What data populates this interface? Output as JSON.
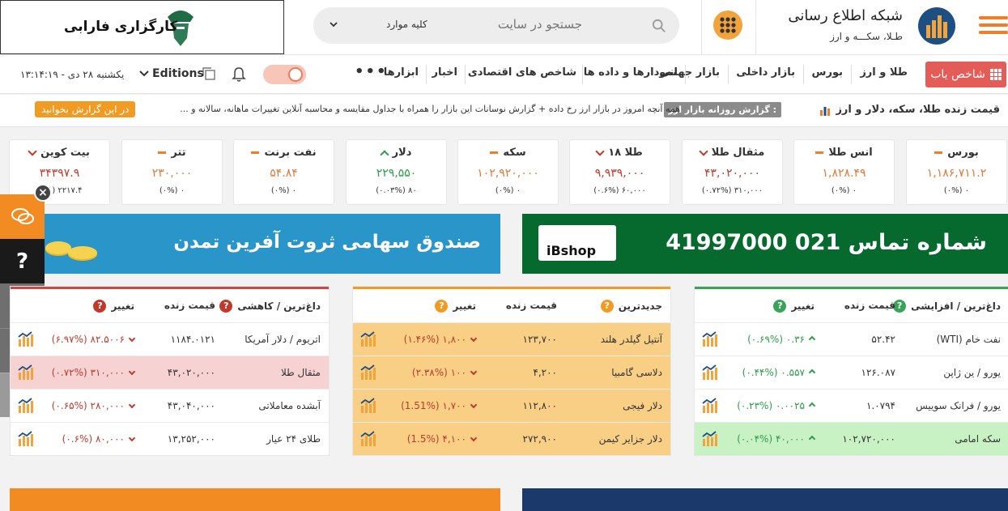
{
  "header": {
    "site_title": "شبکه اطلاع رسانی",
    "site_subtitle": "طـلا، سکـــه و ارز",
    "search_placeholder": "جستجو در سایت",
    "search_scope": "کلیه موارد",
    "ad_text": "کارگزاری فارابی"
  },
  "nav": {
    "finder_label": "شاخص یاب",
    "items": [
      "طلا و ارز",
      "بورس",
      "بازار داخلی",
      "بازار جهانی",
      "نمودارها و داده ها",
      "شاخص های اقتصادی",
      "اخبار",
      "ابزارها"
    ],
    "more": "•••",
    "editions": "Editions",
    "date": "یکشنبه ۲۸ دی - ۱۳:۱۴:۱۹"
  },
  "ticker": {
    "title": "قیمت زنده طلا، سکه، دلار و ارز",
    "badge": "گزارش روزانه بازار ارز :",
    "text": "همه آنچه امروز در بازار ارز رخ داده + گزارش نوسانات این بازار را همراه با جداول مقایسه و محاسبه آنلاین تغییرات ماهانه، سالانه و ...",
    "link": "در این گزارش بخوانید"
  },
  "cards": [
    {
      "name": "بورس",
      "value": "۱,۱۸۶,۷۱۱.۲",
      "change": "۰ (۰%)",
      "dir": "flat"
    },
    {
      "name": "انس طلا",
      "value": "۱,۸۲۸.۴۹",
      "change": "۰ (۰%)",
      "dir": "flat"
    },
    {
      "name": "مثقال طلا",
      "value": "۴۳,۰۲۰,۰۰۰",
      "change": "۳۱۰,۰۰۰ (۰.۷۲%)",
      "dir": "down"
    },
    {
      "name": "طلا ۱۸",
      "value": "۹,۹۳۹,۰۰۰",
      "change": "۶۰,۰۰۰ (۰.۶%)",
      "dir": "down"
    },
    {
      "name": "سکه",
      "value": "۱۰۲,۹۲۰,۰۰۰",
      "change": "۰ (۰%)",
      "dir": "flat"
    },
    {
      "name": "دلار",
      "value": "۲۲۹,۵۵۰",
      "change": "۸۰ (۰.۰۳%)",
      "dir": "up"
    },
    {
      "name": "نفت برنت",
      "value": "۵۴.۸۴",
      "change": "۰ (۰%)",
      "dir": "flat"
    },
    {
      "name": "تتر",
      "value": "۲۳۰,۰۰۰",
      "change": "۰ (۰%)",
      "dir": "flat"
    },
    {
      "name": "بیت کوین",
      "value": "۳۴۳۹۷.۹",
      "change": "۲۲۱۷.۴ (۶%)",
      "dir": "down"
    }
  ],
  "banners": {
    "right": "شماره تماس 021 41997000",
    "right_logo": "iBshop",
    "left": "صندوق سهامی ثروت آفرین تمدن"
  },
  "tables": {
    "gainers": {
      "headers": [
        "داغ‌ترین / افزایشی",
        "قیمت زنده",
        "تغییر"
      ],
      "rows": [
        {
          "name": "نفت خام (WTI)",
          "price": "۵۲.۴۲",
          "change": "۰.۳۶ (۰.۶۹%)"
        },
        {
          "name": "یورو / ین ژاپن",
          "price": "۱۲۶.۰۸۷",
          "change": "۰.۵۵۷ (۰.۴۴%)"
        },
        {
          "name": "یورو / فرانک سوییس",
          "price": "۱.۰۷۹۴",
          "change": "۰.۰۰۲۵ (۰.۲۳%)"
        },
        {
          "name": "سکه امامی",
          "price": "۱۰۲,۷۲۰,۰۰۰",
          "change": "۴۰,۰۰۰ (۰.۰۴%)"
        }
      ]
    },
    "newest": {
      "headers": [
        "جدیدترین",
        "قیمت زنده",
        "تغییر"
      ],
      "rows": [
        {
          "name": "آنتیل گیلدر هلند",
          "price": "۱۲۳,۷۰۰",
          "change": "۱,۸۰۰ (۱.۴۶%)"
        },
        {
          "name": "دلاسی گامبیا",
          "price": "۴,۲۰۰",
          "change": "۱۰۰ (۲.۳۸%)"
        },
        {
          "name": "دلار فیجی",
          "price": "۱۱۲,۸۰۰",
          "change": "۱,۷۰۰ (1.51%)"
        },
        {
          "name": "دلار جزایر کیمن",
          "price": "۲۷۲,۹۰۰",
          "change": "۴,۱۰۰ (1.5%)"
        }
      ]
    },
    "losers": {
      "headers": [
        "داغ‌ترین / کاهشی",
        "قیمت زنده",
        "تغییر"
      ],
      "rows": [
        {
          "name": "اتریوم / دلار آمریکا",
          "price": "۱۱۸۴.۰۱۲۱",
          "change": "۸۲.۵۰۰۶ (۶.۹۷%)"
        },
        {
          "name": "مثقال طلا",
          "price": "۴۳,۰۲۰,۰۰۰",
          "change": "۳۱۰,۰۰۰ (۰.۷۲%)"
        },
        {
          "name": "آبشده معاملاتی",
          "price": "۴۳,۰۴۰,۰۰۰",
          "change": "۲۸۰,۰۰۰ (۰.۶۵%)"
        },
        {
          "name": "طلای ۲۴ عیار",
          "price": "۱۳,۲۵۲,۰۰۰",
          "change": "۸۰,۰۰۰ (۰.۶%)"
        }
      ]
    }
  },
  "colors": {
    "accent": "#f07d27",
    "finder": "#e45c57",
    "green_banner": "#066a2e",
    "blue_banner": "#2a95c9"
  }
}
